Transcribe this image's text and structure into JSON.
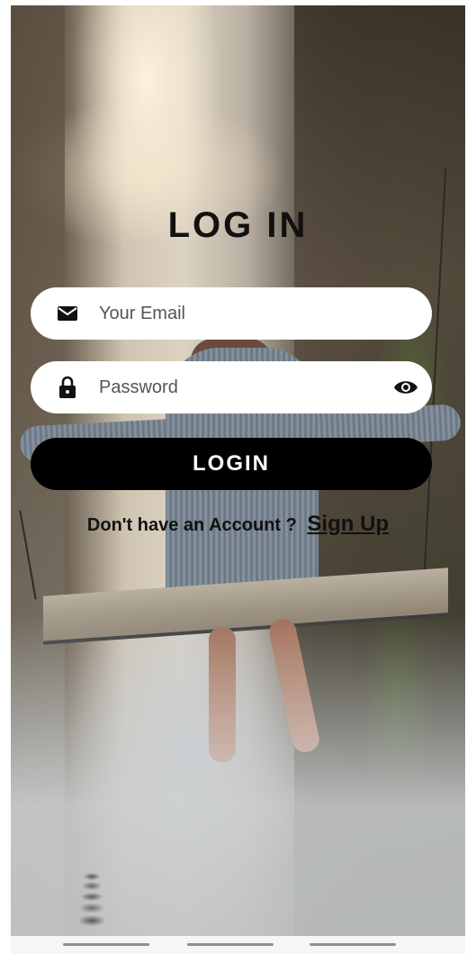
{
  "screen": {
    "title": "LOG IN"
  },
  "email_field": {
    "placeholder": "Your Email",
    "icon": "mail-icon"
  },
  "password_field": {
    "placeholder": "Password",
    "icon": "lock-icon",
    "toggle_icon": "eye-icon"
  },
  "login_button": {
    "label": "LOGIN"
  },
  "signup": {
    "prompt": "Don't have an Account ?",
    "link_label": "Sign Up"
  },
  "colors": {
    "button_bg": "#000000",
    "field_bg": "#ffffff",
    "title_color": "#111111"
  }
}
